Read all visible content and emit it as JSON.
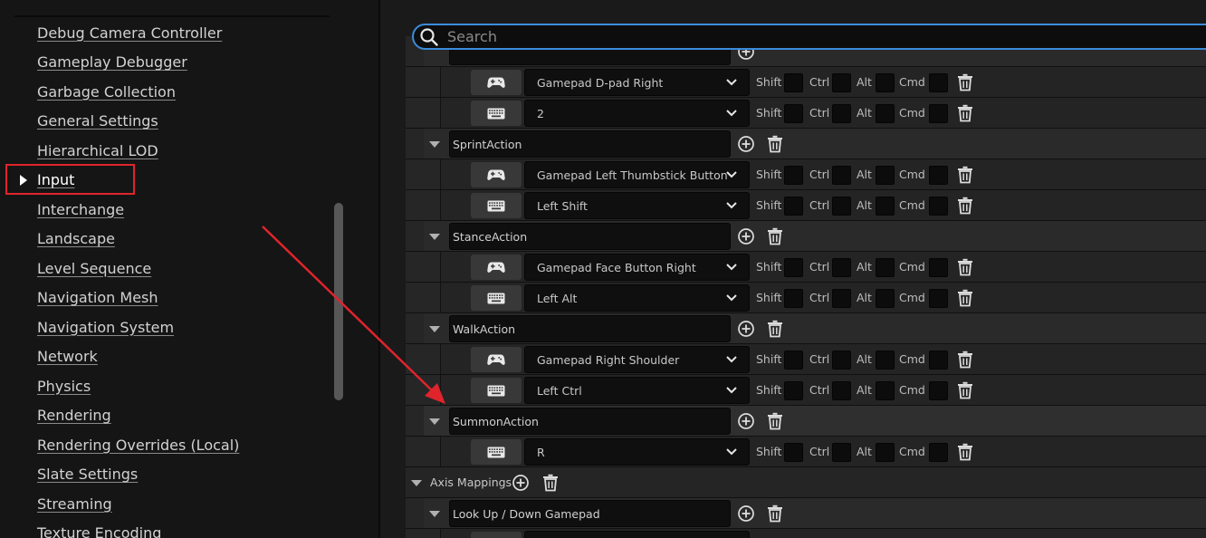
{
  "settings_list": {
    "items": [
      {
        "label": "Debug Camera Controller"
      },
      {
        "label": "Gameplay Debugger"
      },
      {
        "label": "Garbage Collection"
      },
      {
        "label": "General Settings"
      },
      {
        "label": "Hierarchical LOD"
      },
      {
        "label": "Input",
        "selected": true
      },
      {
        "label": "Interchange"
      },
      {
        "label": "Landscape"
      },
      {
        "label": "Level Sequence"
      },
      {
        "label": "Navigation Mesh"
      },
      {
        "label": "Navigation System"
      },
      {
        "label": "Network"
      },
      {
        "label": "Physics"
      },
      {
        "label": "Rendering"
      },
      {
        "label": "Rendering Overrides (Local)"
      },
      {
        "label": "Slate Settings"
      },
      {
        "label": "Streaming"
      },
      {
        "label": "Texture Encoding"
      }
    ]
  },
  "search": {
    "placeholder": "Search",
    "value": ""
  },
  "modifiers": {
    "shift": "Shift",
    "ctrl": "Ctrl",
    "alt": "Alt",
    "cmd": "Cmd"
  },
  "action_mappings": {
    "partial_top": [
      {
        "device": "gamepad-icon",
        "key": "Gamepad D-pad Right"
      },
      {
        "device": "keyboard-icon",
        "key": "2"
      }
    ],
    "groups": [
      {
        "name": "SprintAction",
        "keys": [
          {
            "device": "gamepad-icon",
            "key": "Gamepad Left Thumbstick Button"
          },
          {
            "device": "keyboard-icon",
            "key": "Left Shift"
          }
        ]
      },
      {
        "name": "StanceAction",
        "keys": [
          {
            "device": "gamepad-icon",
            "key": "Gamepad Face Button Right"
          },
          {
            "device": "keyboard-icon",
            "key": "Left Alt"
          }
        ]
      },
      {
        "name": "WalkAction",
        "keys": [
          {
            "device": "gamepad-icon",
            "key": "Gamepad Right Shoulder"
          },
          {
            "device": "keyboard-icon",
            "key": "Left Ctrl"
          }
        ]
      },
      {
        "name": "SummonAction",
        "highlighted": true,
        "keys": [
          {
            "device": "keyboard-icon",
            "key": "R"
          }
        ]
      }
    ]
  },
  "axis_mappings": {
    "label": "Axis Mappings",
    "groups": [
      {
        "name": "Look Up / Down Gamepad"
      }
    ]
  },
  "colors": {
    "annotation_red": "#e0242c",
    "search_focus": "#3c8cdc",
    "panel_bg": "#1a1a1a"
  }
}
